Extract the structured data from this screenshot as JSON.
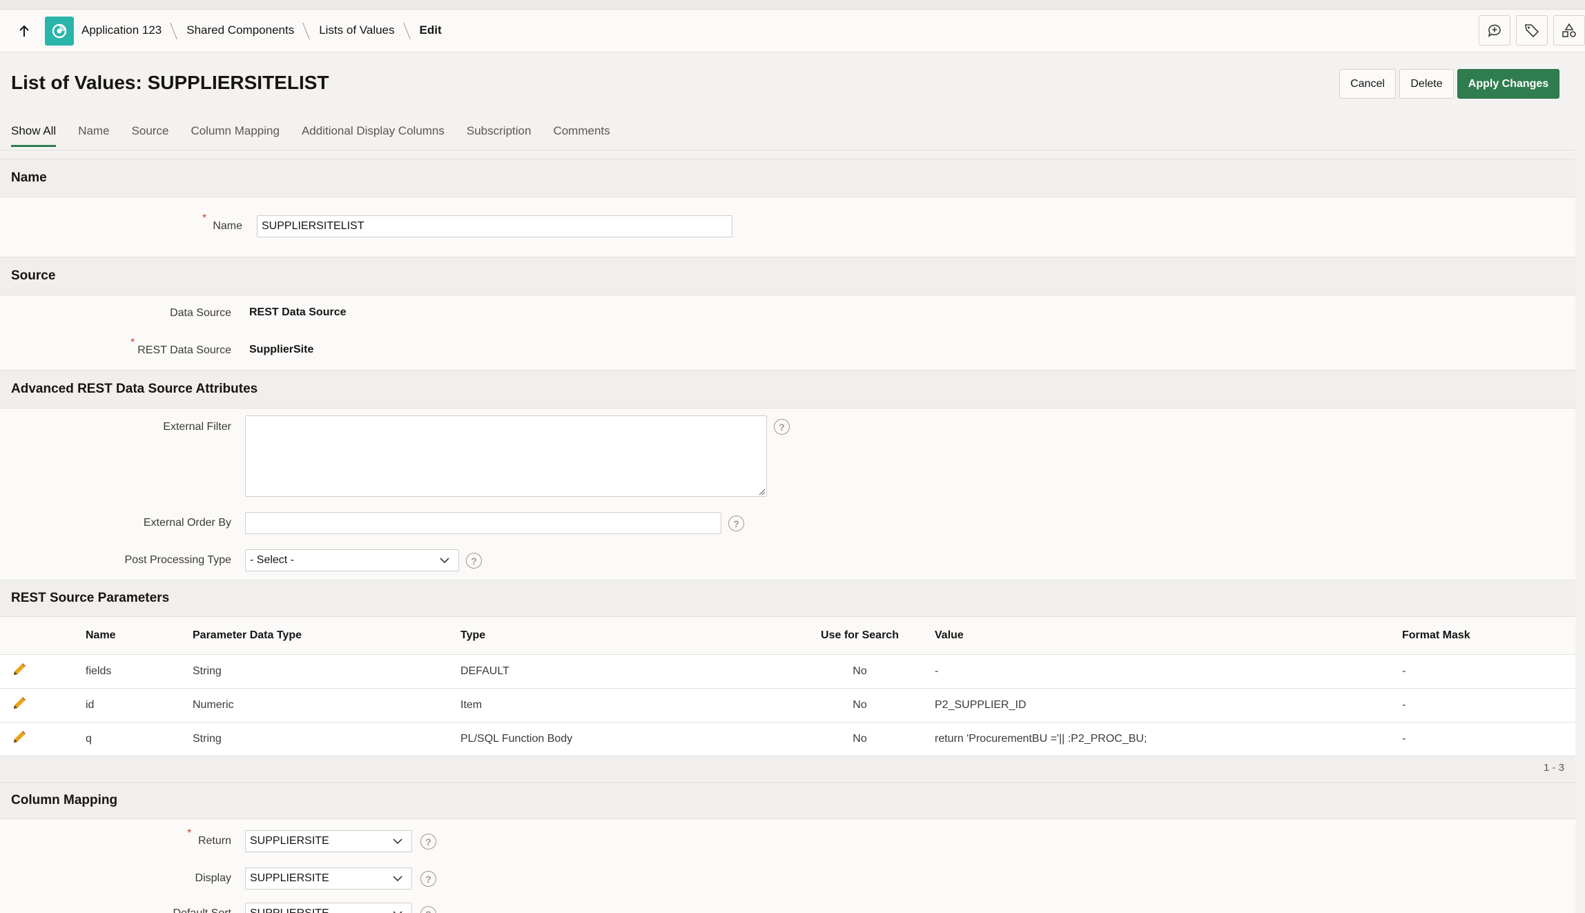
{
  "breadcrumb": {
    "items": [
      "Application 123",
      "Shared Components",
      "Lists of Values"
    ],
    "current": "Edit"
  },
  "header": {
    "title": "List of Values: SUPPLIERSITELIST",
    "cancel_label": "Cancel",
    "delete_label": "Delete",
    "apply_label": "Apply Changes"
  },
  "tabs": [
    "Show All",
    "Name",
    "Source",
    "Column Mapping",
    "Additional Display Columns",
    "Subscription",
    "Comments"
  ],
  "name_region": {
    "title": "Name",
    "name_label": "Name",
    "name_value": "SUPPLIERSITELIST"
  },
  "source_region": {
    "title": "Source",
    "data_source_label": "Data Source",
    "data_source_value": "REST Data Source",
    "rest_source_label": "REST Data Source",
    "rest_source_value": "SupplierSite"
  },
  "advanced_region": {
    "title": "Advanced REST Data Source Attributes",
    "external_filter_label": "External Filter",
    "external_filter_value": "",
    "external_order_label": "External Order By",
    "external_order_value": "",
    "post_processing_label": "Post Processing Type",
    "post_processing_value": "- Select -"
  },
  "params_region": {
    "title": "REST Source Parameters",
    "columns": [
      "Name",
      "Parameter Data Type",
      "Type",
      "Use for Search",
      "Value",
      "Format Mask"
    ],
    "rows": [
      {
        "name": "fields",
        "data_type": "String",
        "type": "DEFAULT",
        "use_for_search": "No",
        "value": "-",
        "format_mask": "-"
      },
      {
        "name": "id",
        "data_type": "Numeric",
        "type": "Item",
        "use_for_search": "No",
        "value": "P2_SUPPLIER_ID",
        "format_mask": "-"
      },
      {
        "name": "q",
        "data_type": "String",
        "type": "PL/SQL Function Body",
        "use_for_search": "No",
        "value": "return 'ProcurementBU ='|| :P2_PROC_BU;",
        "format_mask": "-"
      }
    ],
    "pagination": "1 - 3"
  },
  "mapping_region": {
    "title": "Column Mapping",
    "return_label": "Return",
    "return_value": "SUPPLIERSITE",
    "display_label": "Display",
    "display_value": "SUPPLIERSITE",
    "default_sort_label": "Default Sort",
    "default_sort_value": "SUPPLIERSITE"
  },
  "colors": {
    "accent": "#2f7d4f",
    "app_icon": "#2bb5aa",
    "required": "#c74634",
    "edit_pencil": "#e8a317"
  }
}
